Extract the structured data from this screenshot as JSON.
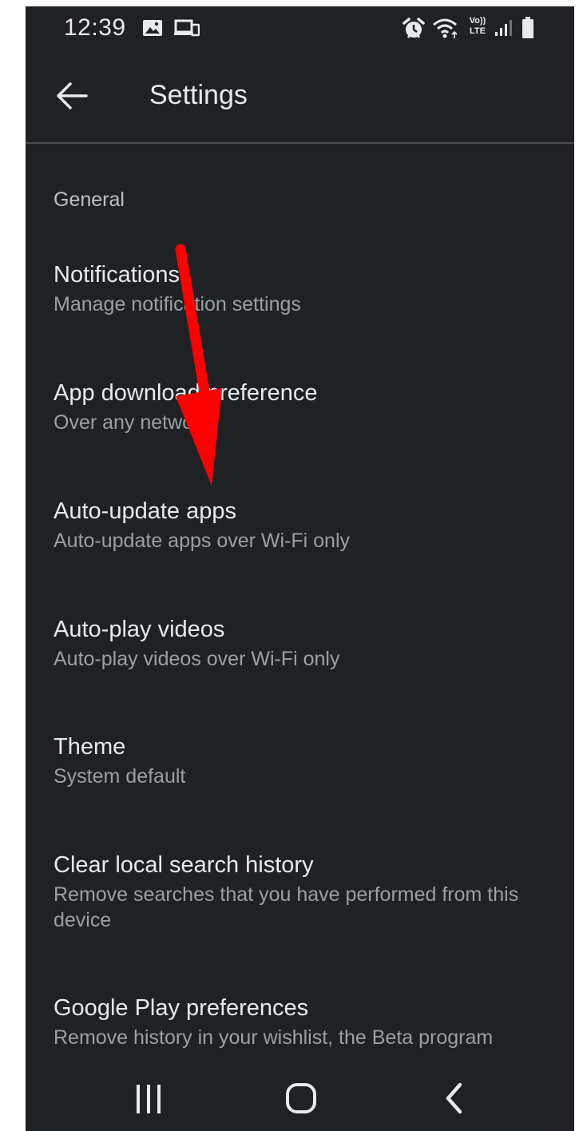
{
  "status_bar": {
    "time": "12:39",
    "icons": [
      "image-icon",
      "cast-icon",
      "alarm-icon",
      "wifi-icon",
      "volte-icon",
      "signal-icon",
      "battery-icon"
    ],
    "volte_label_top": "Vo))",
    "volte_label_bottom": "LTE"
  },
  "app_bar": {
    "back_icon": "back-arrow-icon",
    "title": "Settings"
  },
  "settings": {
    "section": "General",
    "items": [
      {
        "title": "Notifications",
        "subtitle": "Manage notification settings"
      },
      {
        "title": "App download preference",
        "subtitle": "Over any network"
      },
      {
        "title": "Auto-update apps",
        "subtitle": "Auto-update apps over Wi-Fi only"
      },
      {
        "title": "Auto-play videos",
        "subtitle": "Auto-play videos over Wi-Fi only"
      },
      {
        "title": "Theme",
        "subtitle": "System default"
      },
      {
        "title": "Clear local search history",
        "subtitle": "Remove searches that you have performed from this device"
      },
      {
        "title": "Google Play preferences",
        "subtitle": "Remove history in your wishlist, the Beta program"
      }
    ]
  },
  "nav_bar": {
    "icons": [
      "recents-icon",
      "home-icon",
      "back-icon"
    ]
  },
  "annotation": {
    "color": "#ff0000"
  }
}
